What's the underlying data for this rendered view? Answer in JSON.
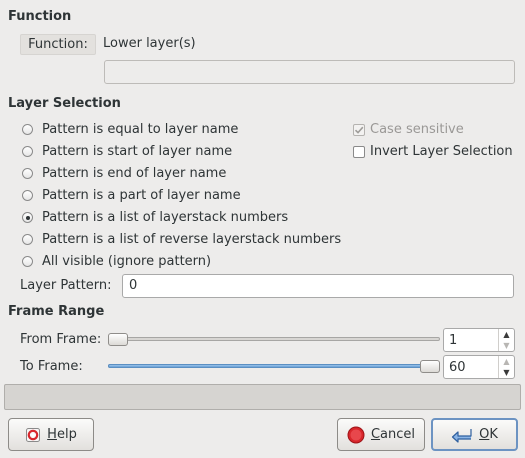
{
  "function_section": {
    "title": "Function",
    "button_label": "Function:",
    "value": "Lower layer(s)",
    "extra_field": ""
  },
  "layer_selection": {
    "title": "Layer Selection",
    "options": [
      "Pattern is equal to layer name",
      "Pattern is start of layer name",
      "Pattern is end of layer name",
      "Pattern is a part of layer name",
      "Pattern is a list of layerstack numbers",
      "Pattern is a list of reverse layerstack numbers",
      "All visible (ignore pattern)"
    ],
    "selected_index": 4,
    "case_sensitive_label": "Case sensitive",
    "case_sensitive_checked": true,
    "case_sensitive_enabled": false,
    "invert_label": "Invert Layer Selection",
    "invert_checked": false,
    "pattern_label": "Layer Pattern:",
    "pattern_value": "0"
  },
  "frame_range": {
    "title": "Frame Range",
    "from_label": "From Frame:",
    "from_value": "1",
    "from_slider_fraction": 0.0,
    "to_label": "To Frame:",
    "to_value": "60",
    "to_slider_fraction": 1.0
  },
  "buttons": {
    "help": "Help",
    "cancel": "Cancel",
    "ok": "OK"
  },
  "colors": {
    "window_bg": "#edeceb",
    "slider_fill": "#6aa0d6",
    "cancel_icon": "#d8262b",
    "ok_icon": "#3b73b9"
  }
}
